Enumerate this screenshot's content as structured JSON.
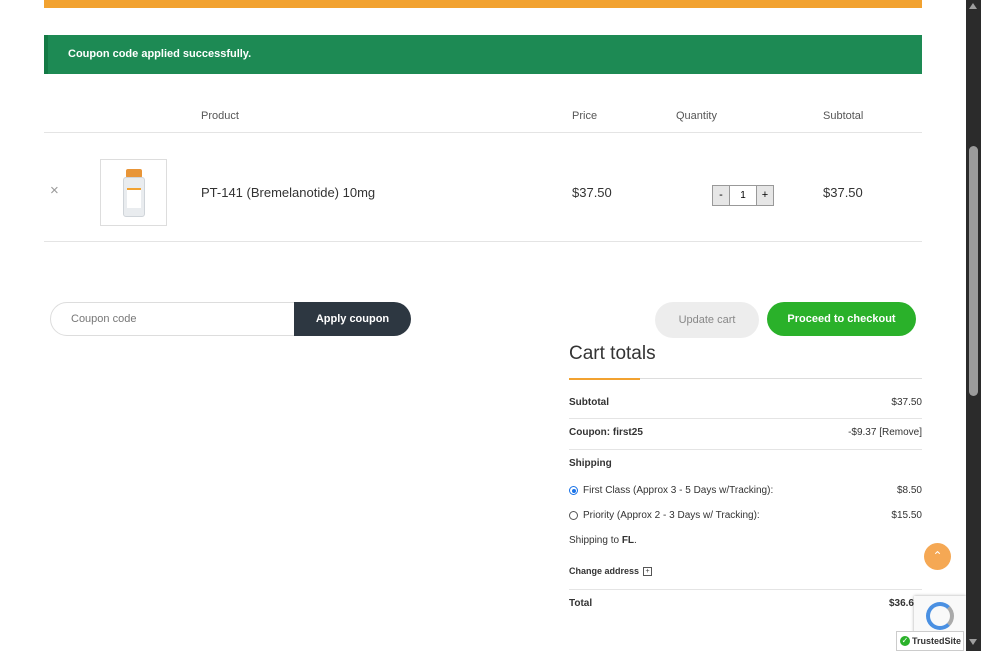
{
  "notice": {
    "message": "Coupon code applied successfully."
  },
  "table": {
    "headers": {
      "product": "Product",
      "price": "Price",
      "quantity": "Quantity",
      "subtotal": "Subtotal"
    },
    "items": [
      {
        "remove": "×",
        "name": "PT-141 (Bremelanotide) 10mg",
        "price": "$37.50",
        "quantity": "1",
        "subtotal": "$37.50",
        "thumbnail": "product-vial-image"
      }
    ],
    "qty_minus": "-",
    "qty_plus": "+"
  },
  "coupon": {
    "placeholder": "Coupon code",
    "apply_label": "Apply coupon"
  },
  "actions": {
    "update_label": "Update cart",
    "checkout_label": "Proceed to checkout"
  },
  "totals": {
    "title": "Cart totals",
    "subtotal_label": "Subtotal",
    "subtotal_value": "$37.50",
    "coupon_label": "Coupon: first25",
    "coupon_value": "-$9.37 [Remove]",
    "shipping_label": "Shipping",
    "shipping_options": [
      {
        "label": "First Class (Approx 3 - 5 Days w/Tracking):",
        "value": "$8.50",
        "selected": true
      },
      {
        "label": "Priority (Approx 2 - 3 Days w/ Tracking):",
        "value": "$15.50",
        "selected": false
      }
    ],
    "shipping_to_prefix": "Shipping to ",
    "shipping_to_state": "FL",
    "shipping_to_suffix": ".",
    "change_address": "Change address",
    "total_label": "Total",
    "total_value": "$36.6"
  },
  "widgets": {
    "scroll_top_icon": "chevron-up-icon",
    "scroll_top_glyph": "⌃",
    "trusted_site": "TrustedSite"
  },
  "colors": {
    "accent_orange": "#f2a230",
    "notice_green": "#1d8a54",
    "checkout_green": "#2ab12a",
    "dark_button": "#2d3741"
  }
}
